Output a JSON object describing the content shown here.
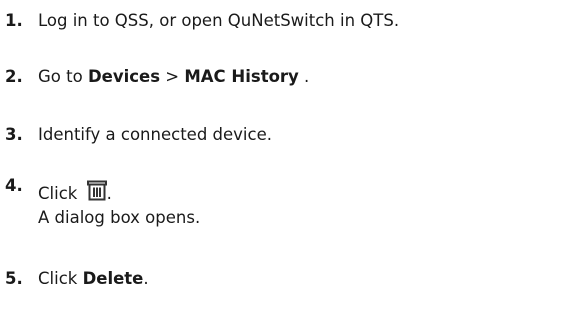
{
  "steps": [
    {
      "number": "1.",
      "text": "Log in to QSS, or open QuNetSwitch in QTS."
    },
    {
      "number": "2.",
      "prefix": "Go to ",
      "menu": "Devices",
      "separator": " > ",
      "submenu": "MAC History",
      "suffix": " ."
    },
    {
      "number": "3.",
      "text": "Identify a connected device."
    },
    {
      "number": "4.",
      "prefix": "Click ",
      "icon": "trash-icon",
      "suffix": ".",
      "result": "A dialog box opens."
    },
    {
      "number": "5.",
      "prefix": "Click ",
      "button": "Delete",
      "suffix": "."
    }
  ]
}
